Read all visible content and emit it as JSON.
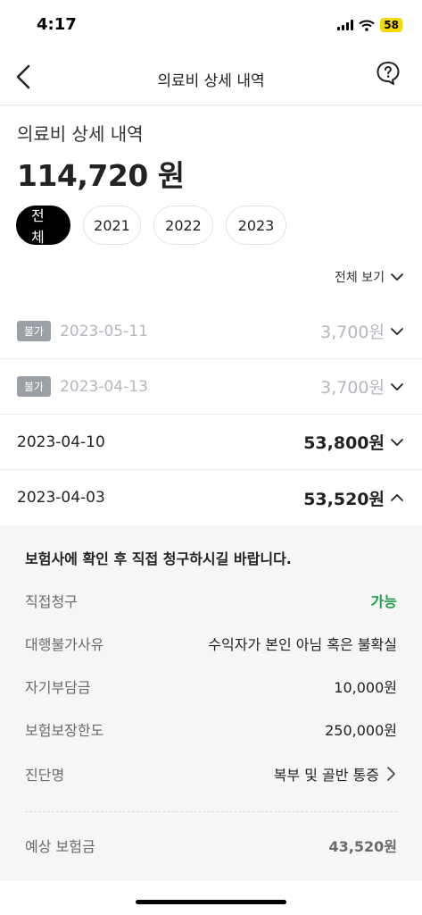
{
  "status_bar": {
    "time": "4:17",
    "battery": "58"
  },
  "nav": {
    "title": "의료비 상세 내역",
    "back_icon": "back-arrow-icon",
    "help_icon": "help-bubble-icon"
  },
  "summary": {
    "label": "의료비 상세 내역",
    "amount": "114,720 원"
  },
  "year_tabs": [
    "전체",
    "2021",
    "2022",
    "2023"
  ],
  "active_tab": "전체",
  "view_all": "전체 보기",
  "records": [
    {
      "badge": "불가",
      "date": "2023-05-11",
      "amount": "3,700원"
    },
    {
      "badge": "불가",
      "date": "2023-04-13",
      "amount": "3,700원"
    },
    {
      "date": "2023-04-10",
      "amount": "53,800원"
    },
    {
      "date": "2023-04-03",
      "amount": "53,520원",
      "expanded": true
    }
  ],
  "detail": {
    "notice": "보험사에 확인 후 직접 청구하시길 바랍니다.",
    "rows": [
      {
        "label": "직접청구",
        "value": "가능"
      },
      {
        "label": "대행불가사유",
        "value": "수익자가 본인 아님 혹은 불확실"
      },
      {
        "label": "자기부담금",
        "value": "10,000원"
      },
      {
        "label": "보험보장한도",
        "value": "250,000원"
      },
      {
        "label": "진단명",
        "value": "복부 및 골반 통증"
      }
    ],
    "estimate": {
      "label": "예상 보험금",
      "value": "43,520원"
    }
  },
  "colors": {
    "available_green": "#21a04a",
    "badge_gray": "#9aa0a6",
    "active_tab": "#000000"
  }
}
